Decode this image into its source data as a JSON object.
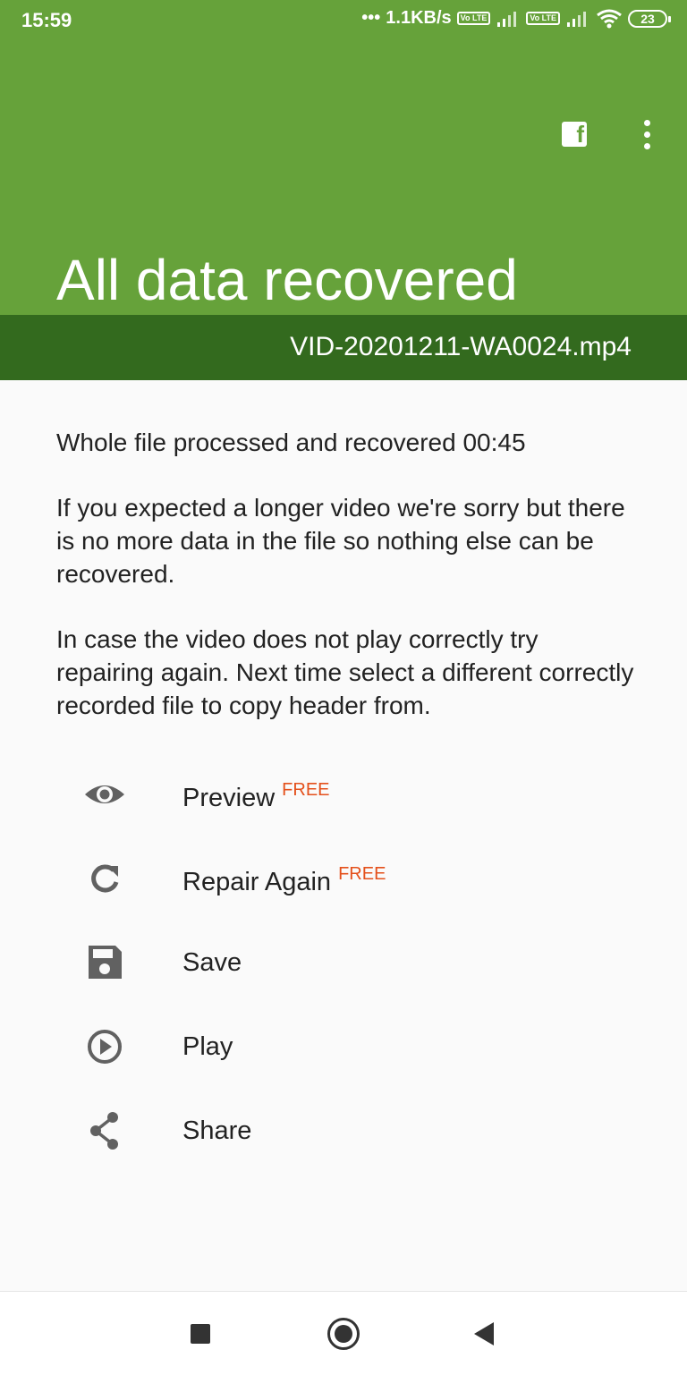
{
  "status": {
    "time": "15:59",
    "network_speed": "1.1KB/s",
    "volte": "Vo LTE",
    "battery": "23"
  },
  "header": {
    "title": "All data recovered",
    "file_name": "VID-20201211-WA0024.mp4"
  },
  "colors": {
    "app_bar": "#66a23a",
    "file_bar": "#336a1e",
    "badge": "#e4501b"
  },
  "content": {
    "paragraph1": "Whole file processed and recovered 00:45",
    "paragraph2": "If you expected a longer video we're sorry but there is no more data in the file so nothing else can be recovered.",
    "paragraph3": "In case the video does not play correctly try repairing again. Next time select a different correctly recorded file to copy header from."
  },
  "actions": {
    "preview": {
      "label": "Preview",
      "badge": "FREE",
      "icon": "eye-icon"
    },
    "repair": {
      "label": "Repair Again",
      "badge": "FREE",
      "icon": "refresh-icon"
    },
    "save": {
      "label": "Save",
      "icon": "floppy-disk-icon"
    },
    "play": {
      "label": "Play",
      "icon": "play-circle-icon"
    },
    "share": {
      "label": "Share",
      "icon": "share-icon"
    }
  }
}
